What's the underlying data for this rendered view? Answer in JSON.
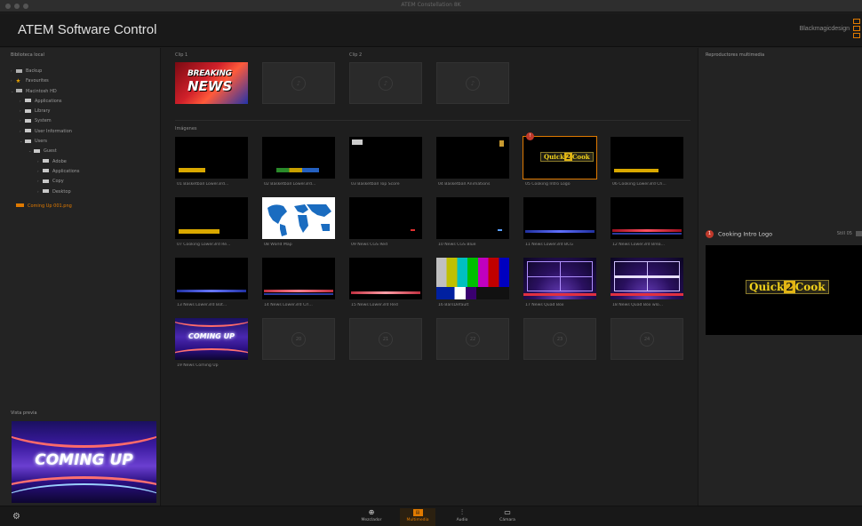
{
  "window": {
    "title": "ATEM Constellation 8K"
  },
  "header": {
    "app_title": "ATEM Software Control",
    "brand": "Blackmagicdesign"
  },
  "left_panel": {
    "title": "Biblioteca local",
    "tree": [
      {
        "label": "Backup",
        "icon": "drive-icon"
      },
      {
        "label": "Favourites",
        "icon": "star-icon"
      },
      {
        "label": "Macintosh HD",
        "icon": "drive-icon"
      },
      {
        "label": "Applications",
        "icon": "folder-icon"
      },
      {
        "label": "Library",
        "icon": "folder-icon"
      },
      {
        "label": "System",
        "icon": "folder-icon"
      },
      {
        "label": "User Information",
        "icon": "folder-icon"
      },
      {
        "label": "Users",
        "icon": "folder-icon"
      },
      {
        "label": "Guest",
        "icon": "folder-icon"
      },
      {
        "label": "Adobe",
        "icon": "folder-icon"
      },
      {
        "label": "Applications",
        "icon": "folder-icon"
      },
      {
        "label": "Copy",
        "icon": "folder-icon"
      },
      {
        "label": "Desktop",
        "icon": "folder-icon"
      }
    ],
    "file": "Coming Up 001.png",
    "preview_title": "Vista previa",
    "preview_text": "COMING UP"
  },
  "center": {
    "clip1_title": "Clip 1",
    "clip2_title": "Clip 2",
    "images_title": "Imágenes",
    "breaking_news_line1": "BREAKING",
    "breaking_news_line2": "NEWS",
    "stills": [
      {
        "caption": "01 Basketball Lower3rd..."
      },
      {
        "caption": "02 Basketball Lower3rd..."
      },
      {
        "caption": "03 Basketball Top Score"
      },
      {
        "caption": "04 Basketball Animations"
      },
      {
        "caption": "05 Cooking Intro Logo"
      },
      {
        "caption": "06 Cooking Lower3rd Ch..."
      },
      {
        "caption": "07 Cooking Lower3rd Re..."
      },
      {
        "caption": "08 World Map"
      },
      {
        "caption": "09 News CGS Red"
      },
      {
        "caption": "10 News CGS Blue"
      },
      {
        "caption": "11 News Lower3rd BCG"
      },
      {
        "caption": "12 News Lower3rd Brea..."
      },
      {
        "caption": "13 News Lower3rd Bot..."
      },
      {
        "caption": "14 News Lower3rd Crl..."
      },
      {
        "caption": "15 News Lower3rd Red"
      },
      {
        "caption": "16 BarsDefault"
      },
      {
        "caption": "17 News Quad Box"
      },
      {
        "caption": "18 News Quad Box wlo..."
      },
      {
        "caption": "19 News Coming Up"
      }
    ],
    "empty_slots": [
      "20",
      "21",
      "22",
      "23",
      "24"
    ],
    "coming_up_text": "COMING UP",
    "selected_badge": "!"
  },
  "right_panel": {
    "title": "Reproductores multimedia",
    "player_badge": "1",
    "player_title": "Cooking Intro Logo",
    "clip_label": "Still 05",
    "logo_quick": "Quick",
    "logo_two": "2",
    "logo_cook": "Cook"
  },
  "bottom_tabs": [
    {
      "label": "Mezclador",
      "icon": "switcher-icon",
      "active": false
    },
    {
      "label": "Multimedia",
      "icon": "media-icon",
      "active": true
    },
    {
      "label": "Audio",
      "icon": "audio-icon",
      "active": false
    },
    {
      "label": "Cámara",
      "icon": "camera-icon",
      "active": false
    }
  ],
  "colors": {
    "accent": "#e07a00",
    "background": "#1e1e1e",
    "panel": "#232323"
  }
}
